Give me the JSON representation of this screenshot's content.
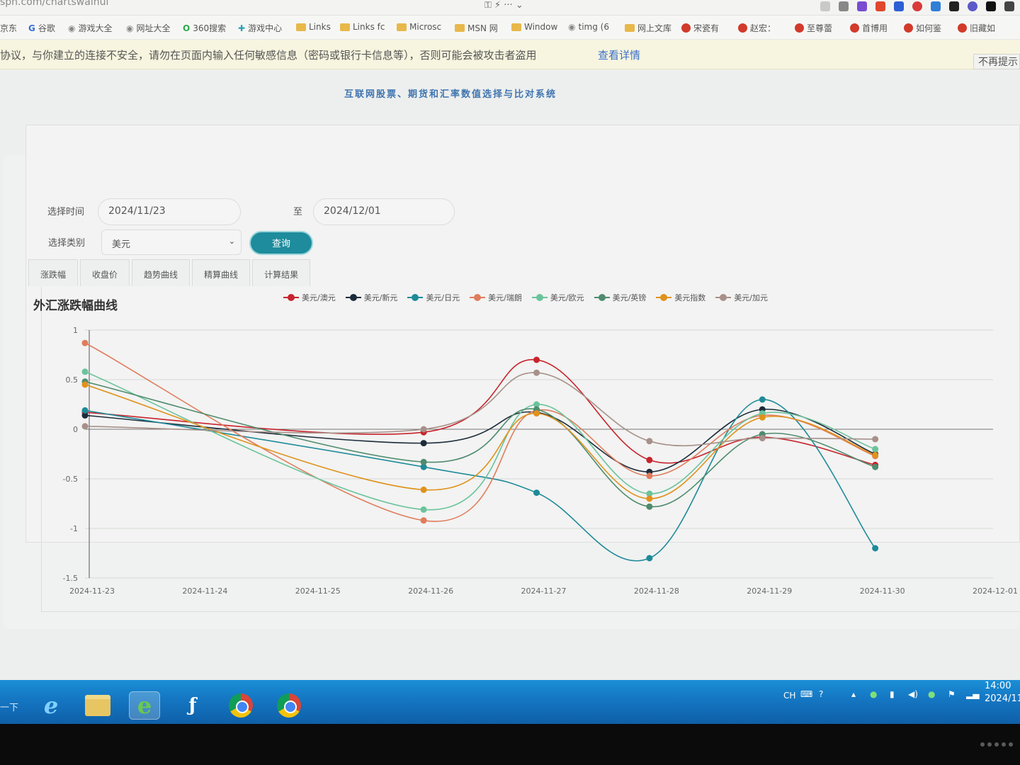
{
  "browser": {
    "url": "sph.com/chartswaihui",
    "bookmarks": [
      {
        "label": "京东",
        "icon": "none"
      },
      {
        "label": "谷歌",
        "icon": "google-icon"
      },
      {
        "label": "游戏大全",
        "icon": "globe-icon"
      },
      {
        "label": "网址大全",
        "icon": "globe-icon"
      },
      {
        "label": "360搜索",
        "icon": "search-icon"
      },
      {
        "label": "游戏中心",
        "icon": "plus-icon"
      },
      {
        "label": "Links",
        "icon": "folder-icon"
      },
      {
        "label": "Links fc",
        "icon": "folder-icon"
      },
      {
        "label": "Microsc",
        "icon": "folder-icon"
      },
      {
        "label": "MSN 网",
        "icon": "folder-icon"
      },
      {
        "label": "Window",
        "icon": "folder-icon"
      },
      {
        "label": "timg (6",
        "icon": "globe-icon"
      },
      {
        "label": "网上文库",
        "icon": "folder-icon"
      },
      {
        "label": "宋瓷有",
        "icon": "weibo-icon"
      },
      {
        "label": "赵宏：",
        "icon": "weibo-icon"
      },
      {
        "label": "至尊蕾",
        "icon": "weibo-icon"
      },
      {
        "label": "首博用",
        "icon": "weibo-icon"
      },
      {
        "label": "如何鉴",
        "icon": "weibo-icon"
      },
      {
        "label": "旧藏如",
        "icon": "weibo-icon"
      }
    ],
    "warning": {
      "text": "协议，与你建立的连接不安全，请勿在页面内输入任何敏感信息（密码或银行卡信息等），否则可能会被攻击者盗用",
      "link": "查看详情",
      "dismiss": "不再提示"
    }
  },
  "page": {
    "title": "互联网股票、期货和汇率数值选择与比对系统",
    "form": {
      "time_label": "选择时间",
      "start_date": "2024/11/23",
      "to_label": "至",
      "end_date": "2024/12/01",
      "category_label": "选择类别",
      "category_value": "美元",
      "query_button": "查询"
    },
    "tabs": [
      "涨跌幅",
      "收盘价",
      "趋势曲线",
      "精算曲线",
      "计算结果"
    ],
    "chart_title": "外汇涨跌幅曲线"
  },
  "chart_data": {
    "type": "line",
    "x": [
      "2024-11-23",
      "2024-11-24",
      "2024-11-25",
      "2024-11-26",
      "2024-11-27",
      "2024-11-28",
      "2024-11-29",
      "2024-11-30",
      "2024-12-01"
    ],
    "ylim": [
      -1.5,
      1
    ],
    "yticks": [
      1,
      0.5,
      0,
      -0.5,
      -1,
      -1.5
    ],
    "ytick_labels": [
      "1",
      "0.5",
      "0",
      "-0.5",
      "-1",
      "-1.5"
    ],
    "grid": true,
    "legend_position": "top",
    "series": [
      {
        "name": "美元/澳元",
        "color": "#c8232c",
        "points": [
          [
            0,
            0.17
          ],
          [
            3,
            -0.03
          ],
          [
            4,
            0.7
          ],
          [
            5,
            -0.31
          ],
          [
            6,
            -0.08
          ],
          [
            7,
            -0.36
          ]
        ]
      },
      {
        "name": "美元/新元",
        "color": "#1c2b3a",
        "points": [
          [
            0,
            0.14
          ],
          [
            3,
            -0.14
          ],
          [
            4,
            0.17
          ],
          [
            5,
            -0.43
          ],
          [
            6,
            0.2
          ],
          [
            7,
            -0.25
          ]
        ]
      },
      {
        "name": "美元/日元",
        "color": "#1e8a99",
        "points": [
          [
            0,
            0.19
          ],
          [
            3,
            -0.38
          ],
          [
            4,
            -0.64
          ],
          [
            5,
            -1.3
          ],
          [
            6,
            0.3
          ],
          [
            7,
            -1.2
          ]
        ]
      },
      {
        "name": "美元/瑞朗",
        "color": "#e07c5c",
        "points": [
          [
            0,
            0.87
          ],
          [
            3,
            -0.92
          ],
          [
            4,
            0.19
          ],
          [
            5,
            -0.47
          ],
          [
            6,
            0.14
          ],
          [
            7,
            -0.27
          ]
        ]
      },
      {
        "name": "美元/欧元",
        "color": "#6bc39c",
        "points": [
          [
            0,
            0.58
          ],
          [
            3,
            -0.81
          ],
          [
            4,
            0.25
          ],
          [
            5,
            -0.65
          ],
          [
            6,
            0.16
          ],
          [
            7,
            -0.2
          ]
        ]
      },
      {
        "name": "美元/英镑",
        "color": "#4f8b6e",
        "points": [
          [
            0,
            0.48
          ],
          [
            3,
            -0.33
          ],
          [
            4,
            0.2
          ],
          [
            5,
            -0.78
          ],
          [
            6,
            -0.05
          ],
          [
            7,
            -0.38
          ]
        ]
      },
      {
        "name": "美元指数",
        "color": "#e0921c",
        "points": [
          [
            0,
            0.45
          ],
          [
            3,
            -0.61
          ],
          [
            4,
            0.16
          ],
          [
            5,
            -0.7
          ],
          [
            6,
            0.12
          ],
          [
            7,
            -0.26
          ]
        ]
      },
      {
        "name": "美元/加元",
        "color": "#a8908a",
        "points": [
          [
            0,
            0.03
          ],
          [
            3,
            0.0
          ],
          [
            4,
            0.57
          ],
          [
            5,
            -0.12
          ],
          [
            6,
            -0.09
          ],
          [
            7,
            -0.1
          ]
        ]
      }
    ]
  },
  "taskbar": {
    "start_label": "一下",
    "tray": {
      "lang": "CH",
      "time": "14:00",
      "date": "2024/11"
    }
  }
}
